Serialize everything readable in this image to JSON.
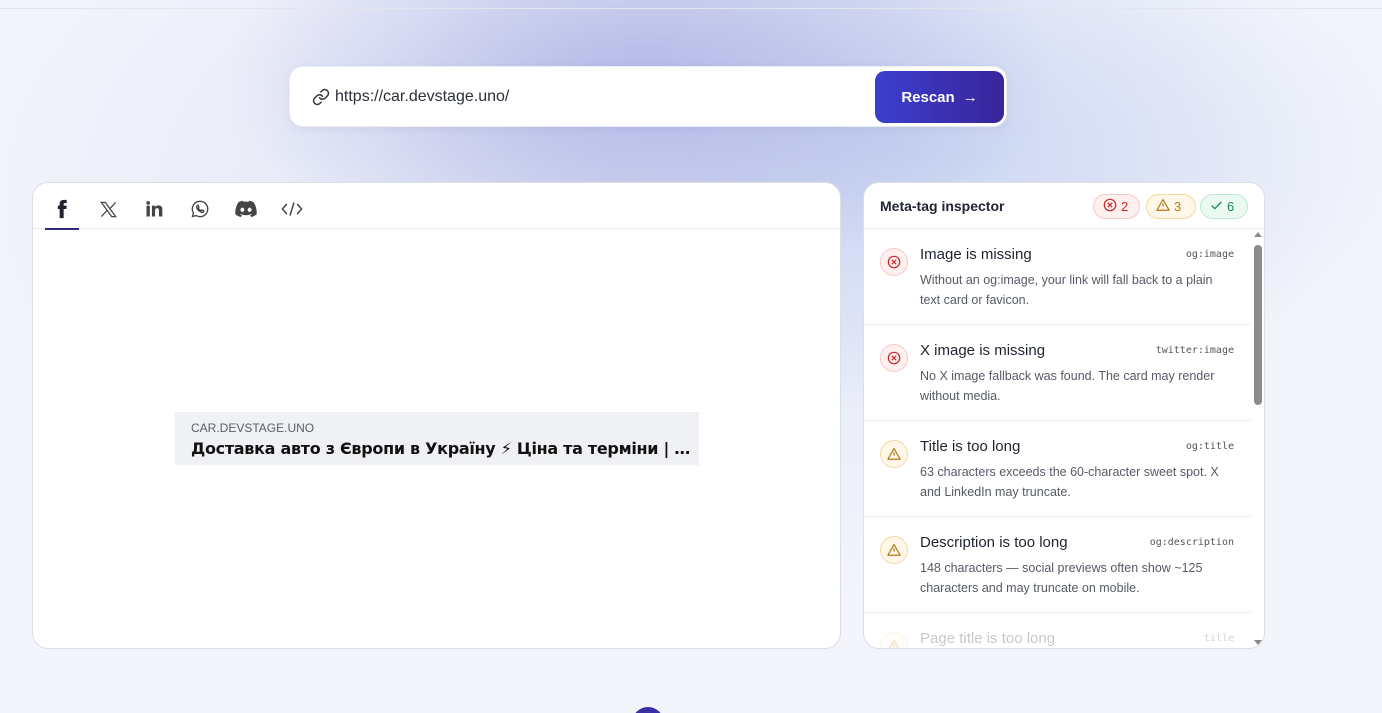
{
  "url_bar": {
    "url_value": "https://car.devstage.uno/",
    "rescan_label": "Rescan",
    "rescan_arrow": "→",
    "link_icon": "link-icon"
  },
  "preview": {
    "tabs": [
      {
        "name": "facebook",
        "icon": "facebook-icon",
        "active": true
      },
      {
        "name": "x",
        "icon": "x-icon",
        "active": false
      },
      {
        "name": "linkedin",
        "icon": "linkedin-icon",
        "active": false
      },
      {
        "name": "whatsapp",
        "icon": "whatsapp-icon",
        "active": false
      },
      {
        "name": "discord",
        "icon": "discord-icon",
        "active": false
      },
      {
        "name": "code",
        "icon": "code-icon",
        "active": false
      }
    ],
    "og_domain": "CAR.DEVSTAGE.UNO",
    "og_title": "Доставка авто з Європи в Україну ⚡ Ціна та терміни | CarS..."
  },
  "inspector": {
    "title": "Meta-tag inspector",
    "counts": {
      "errors": "2",
      "warnings": "3",
      "passed": "6"
    },
    "issues": [
      {
        "severity": "error",
        "title": "Image is missing",
        "tag": "og:image",
        "desc": "Without an og:image, your link will fall back to a plain text card or favicon."
      },
      {
        "severity": "error",
        "title": "X image is missing",
        "tag": "twitter:image",
        "desc": "No X image fallback was found. The card may render without media."
      },
      {
        "severity": "warning",
        "title": "Title is too long",
        "tag": "og:title",
        "desc": "63 characters exceeds the 60-character sweet spot. X and LinkedIn may truncate."
      },
      {
        "severity": "warning",
        "title": "Description is too long",
        "tag": "og:description",
        "desc": "148 characters — social previews often show ~125 characters and may truncate on mobile."
      },
      {
        "severity": "warning",
        "title": "Page title is too long",
        "tag": "title",
        "desc": ""
      }
    ]
  },
  "colors": {
    "accent": "#3a2fa6",
    "error": "#c62828",
    "warning": "#b7791f",
    "success": "#1f8a55"
  }
}
